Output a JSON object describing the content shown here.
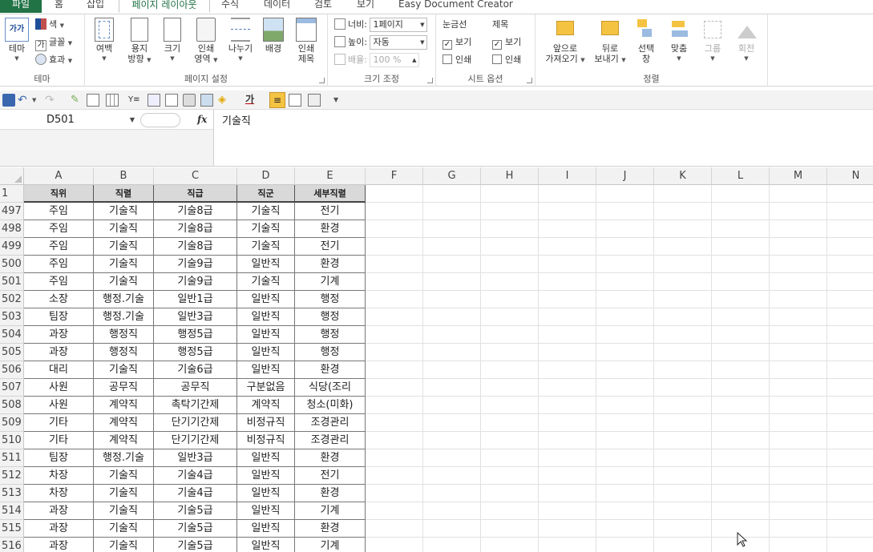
{
  "tabs": {
    "file": "파일",
    "home": "홈",
    "insert": "삽입",
    "page_layout": "페이지 레이아웃",
    "formulas": "수식",
    "data": "데이터",
    "review": "검토",
    "view": "보기",
    "addin": "Easy Document Creator"
  },
  "ribbon": {
    "themes": {
      "theme_label": "테마",
      "theme_icon_text": "가가",
      "colors": "색",
      "fonts": "글꼴",
      "effects": "효과",
      "group": "테마"
    },
    "page_setup": {
      "margins": "여백",
      "orientation_1": "용지",
      "orientation_2": "방향",
      "size": "크기",
      "print_area_1": "인쇄",
      "print_area_2": "영역",
      "breaks": "나누기",
      "background": "배경",
      "print_titles_1": "인쇄",
      "print_titles_2": "제목",
      "group": "페이지 설정"
    },
    "scale": {
      "width_label": "너비:",
      "width_value": "1페이지",
      "height_label": "높이:",
      "height_value": "자동",
      "scale_label": "배율:",
      "scale_value": "100 %",
      "group": "크기 조정"
    },
    "sheet_options": {
      "gridlines": "눈금선",
      "headings": "제목",
      "view": "보기",
      "print": "인쇄",
      "group": "시트 옵션"
    },
    "arrange": {
      "bring_forward_1": "앞으로",
      "bring_forward_2": "가져오기",
      "send_backward_1": "뒤로",
      "send_backward_2": "보내기",
      "selection_pane_1": "선택",
      "selection_pane_2": "창",
      "align": "맞춤",
      "group_btn": "그룹",
      "rotate": "회전",
      "group": "정렬"
    }
  },
  "formula_bar": {
    "name_box": "D501",
    "fx": "fx",
    "content": "기술직"
  },
  "grid": {
    "columns": [
      "A",
      "B",
      "C",
      "D",
      "E",
      "F",
      "G",
      "H",
      "I",
      "J",
      "K",
      "L",
      "M",
      "N"
    ],
    "header_row": {
      "number": "1",
      "cells": [
        "직위",
        "직렬",
        "직급",
        "직군",
        "세부직렬"
      ]
    },
    "rows": [
      {
        "number": "497",
        "cells": [
          "주임",
          "기술직",
          "기술8급",
          "기술직",
          "전기"
        ]
      },
      {
        "number": "498",
        "cells": [
          "주임",
          "기술직",
          "기술8급",
          "기술직",
          "환경"
        ]
      },
      {
        "number": "499",
        "cells": [
          "주임",
          "기술직",
          "기술8급",
          "기술직",
          "전기"
        ]
      },
      {
        "number": "500",
        "cells": [
          "주임",
          "기술직",
          "기술9급",
          "일반직",
          "환경"
        ]
      },
      {
        "number": "501",
        "cells": [
          "주임",
          "기술직",
          "기술9급",
          "기술직",
          "기계"
        ]
      },
      {
        "number": "502",
        "cells": [
          "소장",
          "행정.기술",
          "일반1급",
          "일반직",
          "행정"
        ]
      },
      {
        "number": "503",
        "cells": [
          "팀장",
          "행정.기술",
          "일반3급",
          "일반직",
          "행정"
        ]
      },
      {
        "number": "504",
        "cells": [
          "과장",
          "행정직",
          "행정5급",
          "일반직",
          "행정"
        ]
      },
      {
        "number": "505",
        "cells": [
          "과장",
          "행정직",
          "행정5급",
          "일반직",
          "행정"
        ]
      },
      {
        "number": "506",
        "cells": [
          "대리",
          "기술직",
          "기술6급",
          "일반직",
          "환경"
        ]
      },
      {
        "number": "507",
        "cells": [
          "사원",
          "공무직",
          "공무직",
          "구분없음",
          "식당(조리"
        ]
      },
      {
        "number": "508",
        "cells": [
          "사원",
          "계약직",
          "촉탁기간제",
          "계약직",
          "청소(미화)"
        ]
      },
      {
        "number": "509",
        "cells": [
          "기타",
          "계약직",
          "단기기간제",
          "비정규직",
          "조경관리"
        ]
      },
      {
        "number": "510",
        "cells": [
          "기타",
          "계약직",
          "단기기간제",
          "비정규직",
          "조경관리"
        ]
      },
      {
        "number": "511",
        "cells": [
          "팀장",
          "행정.기술",
          "일반3급",
          "일반직",
          "환경"
        ]
      },
      {
        "number": "512",
        "cells": [
          "차장",
          "기술직",
          "기술4급",
          "일반직",
          "전기"
        ]
      },
      {
        "number": "513",
        "cells": [
          "차장",
          "기술직",
          "기술4급",
          "일반직",
          "환경"
        ]
      },
      {
        "number": "514",
        "cells": [
          "과장",
          "기술직",
          "기술5급",
          "일반직",
          "기계"
        ]
      },
      {
        "number": "515",
        "cells": [
          "과장",
          "기술직",
          "기술5급",
          "일반직",
          "환경"
        ]
      },
      {
        "number": "516",
        "cells": [
          "과장",
          "기술직",
          "기술5급",
          "일반직",
          "기계"
        ]
      }
    ]
  },
  "colors": {
    "accent": "#217346",
    "header_fill": "#d9d9d9",
    "active_cell_border": "#217346"
  }
}
